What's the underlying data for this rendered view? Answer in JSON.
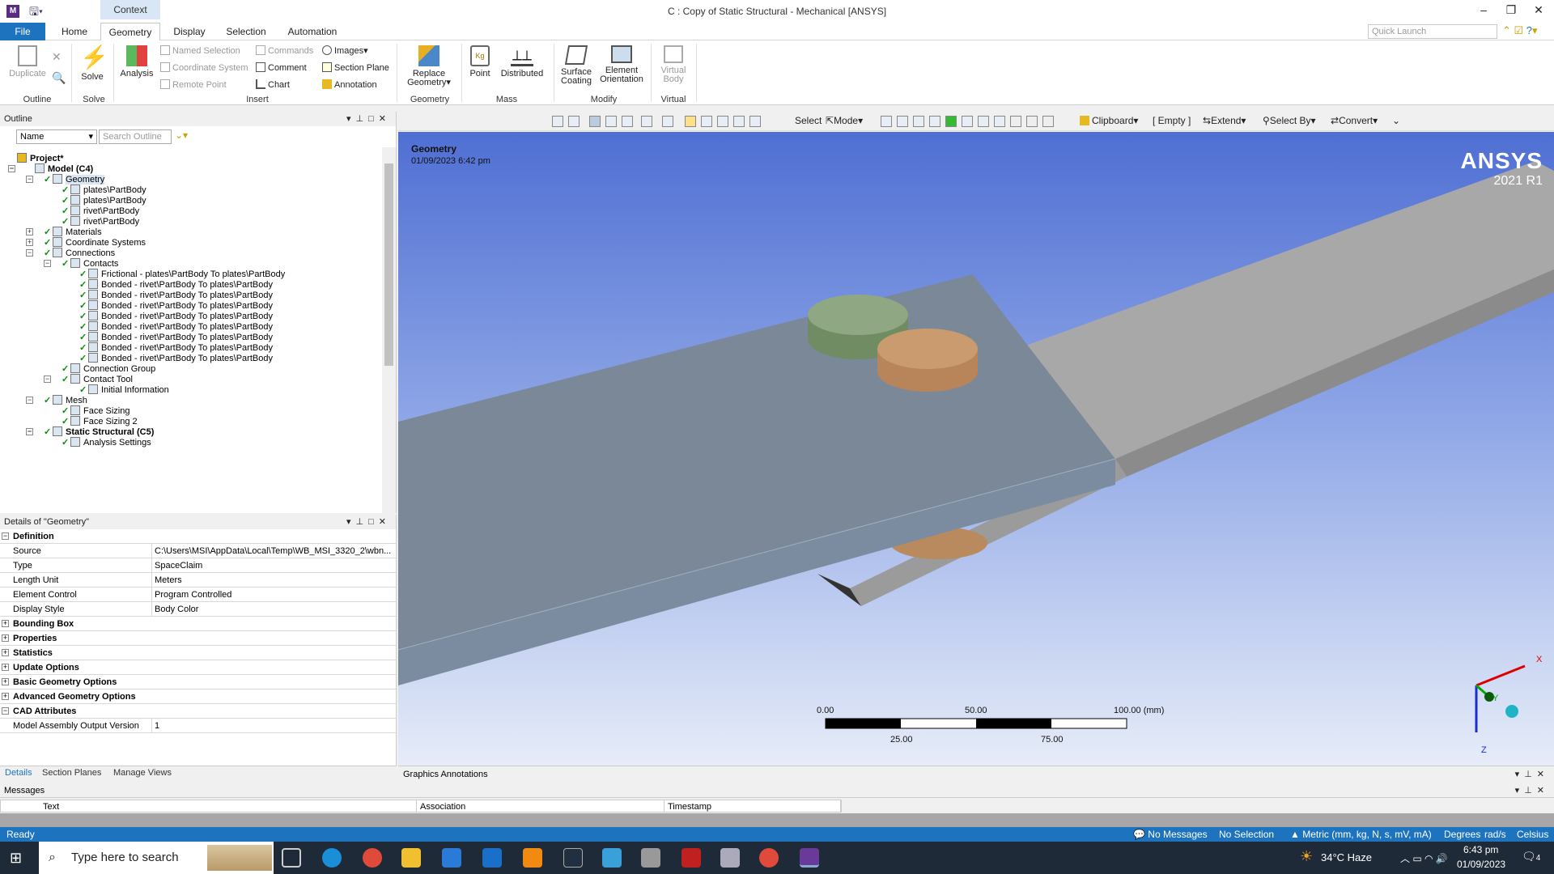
{
  "window": {
    "title": "C : Copy of Static Structural - Mechanical [ANSYS]",
    "context_tab": "Context",
    "min": "–",
    "max": "❐",
    "close": "✕"
  },
  "tabs": [
    "File",
    "Home",
    "Geometry",
    "Display",
    "Selection",
    "Automation"
  ],
  "quick_launch_placeholder": "Quick Launch",
  "ribbon": {
    "duplicate": "Duplicate",
    "outline_grp": "Outline",
    "solve": "Solve",
    "solve_grp": "Solve",
    "analysis": "Analysis",
    "named_selection": "Named Selection",
    "coordinate_system": "Coordinate System",
    "remote_point": "Remote Point",
    "commands": "Commands",
    "comment": "Comment",
    "chart": "Chart",
    "images": "Images",
    "section_plane": "Section Plane",
    "annotation": "Annotation",
    "insert_grp": "Insert",
    "replace_geometry_1": "Replace",
    "replace_geometry_2": "Geometry",
    "geometry_grp": "Geometry",
    "point": "Point",
    "distributed": "Distributed",
    "mass_grp": "Mass",
    "surface_coating_1": "Surface",
    "surface_coating_2": "Coating",
    "element_orientation_1": "Element",
    "element_orientation_2": "Orientation",
    "modify_grp": "Modify",
    "virtual_body_1": "Virtual",
    "virtual_body_2": "Body",
    "virtual_grp": "Virtual"
  },
  "outline": {
    "title": "Outline",
    "filter": "Name",
    "search_placeholder": "Search Outline"
  },
  "tree": [
    {
      "label": "Project*",
      "level": 0,
      "bold": true
    },
    {
      "label": "Model (C4)",
      "level": 1,
      "bold": true,
      "exp": "−"
    },
    {
      "label": "Geometry",
      "level": 2,
      "exp": "−",
      "check": true,
      "sel": true
    },
    {
      "label": "plates\\PartBody",
      "level": 3,
      "check": true
    },
    {
      "label": "plates\\PartBody",
      "level": 3,
      "check": true
    },
    {
      "label": "rivet\\PartBody",
      "level": 3,
      "check": true
    },
    {
      "label": "rivet\\PartBody",
      "level": 3,
      "check": true
    },
    {
      "label": "Materials",
      "level": 2,
      "exp": "+",
      "check": true
    },
    {
      "label": "Coordinate Systems",
      "level": 2,
      "exp": "+",
      "check": true
    },
    {
      "label": "Connections",
      "level": 2,
      "exp": "−",
      "check": true
    },
    {
      "label": "Contacts",
      "level": 3,
      "exp": "−",
      "check": true
    },
    {
      "label": "Frictional - plates\\PartBody To plates\\PartBody",
      "level": 4,
      "check": true
    },
    {
      "label": "Bonded - rivet\\PartBody To plates\\PartBody",
      "level": 4,
      "check": true
    },
    {
      "label": "Bonded - rivet\\PartBody To plates\\PartBody",
      "level": 4,
      "check": true
    },
    {
      "label": "Bonded - rivet\\PartBody To plates\\PartBody",
      "level": 4,
      "check": true
    },
    {
      "label": "Bonded - rivet\\PartBody To plates\\PartBody",
      "level": 4,
      "check": true
    },
    {
      "label": "Bonded - rivet\\PartBody To plates\\PartBody",
      "level": 4,
      "check": true
    },
    {
      "label": "Bonded - rivet\\PartBody To plates\\PartBody",
      "level": 4,
      "check": true
    },
    {
      "label": "Bonded - rivet\\PartBody To plates\\PartBody",
      "level": 4,
      "check": true
    },
    {
      "label": "Bonded - rivet\\PartBody To plates\\PartBody",
      "level": 4,
      "check": true
    },
    {
      "label": "Connection Group",
      "level": 3,
      "check": true
    },
    {
      "label": "Contact Tool",
      "level": 3,
      "exp": "−",
      "check": true
    },
    {
      "label": "Initial Information",
      "level": 4,
      "check": true
    },
    {
      "label": "Mesh",
      "level": 2,
      "exp": "−",
      "check": true
    },
    {
      "label": "Face Sizing",
      "level": 3,
      "check": true
    },
    {
      "label": "Face Sizing 2",
      "level": 3,
      "check": true
    },
    {
      "label": "Static Structural (C5)",
      "level": 2,
      "exp": "−",
      "check": true,
      "bold": true
    },
    {
      "label": "Analysis Settings",
      "level": 3,
      "check": true
    }
  ],
  "details": {
    "title": "Details of \"Geometry\"",
    "rows": [
      {
        "k": "Definition",
        "sec": true,
        "pm": "−"
      },
      {
        "k": "Source",
        "v": "C:\\Users\\MSI\\AppData\\Local\\Temp\\WB_MSI_3320_2\\wbn..."
      },
      {
        "k": "Type",
        "v": "SpaceClaim"
      },
      {
        "k": "Length Unit",
        "v": "Meters"
      },
      {
        "k": "Element Control",
        "v": "Program Controlled"
      },
      {
        "k": "Display Style",
        "v": "Body Color"
      },
      {
        "k": "Bounding Box",
        "sec": true,
        "pm": "+"
      },
      {
        "k": "Properties",
        "sec": true,
        "pm": "+"
      },
      {
        "k": "Statistics",
        "sec": true,
        "pm": "+"
      },
      {
        "k": "Update Options",
        "sec": true,
        "pm": "+"
      },
      {
        "k": "Basic Geometry Options",
        "sec": true,
        "pm": "+"
      },
      {
        "k": "Advanced Geometry Options",
        "sec": true,
        "pm": "+"
      },
      {
        "k": "CAD Attributes",
        "sec": true,
        "pm": "−"
      },
      {
        "k": "Model Assembly Output Version",
        "v": "1"
      }
    ],
    "tabs": [
      "Details",
      "Section Planes",
      "Manage Views"
    ]
  },
  "gtoolbar": {
    "select": "Select",
    "mode": "Mode",
    "clipboard": "Clipboard",
    "empty": "[ Empty ]",
    "extend": "Extend",
    "select_by": "Select By",
    "convert": "Convert"
  },
  "viewport": {
    "title": "Geometry",
    "date": "01/09/2023 6:42 pm",
    "logo": "ANSYS",
    "version": "2021 R1",
    "scale": {
      "s0": "0.00",
      "s50": "50.00",
      "s100": "100.00 (mm)",
      "s25": "25.00",
      "s75": "75.00"
    },
    "axes": {
      "x": "X",
      "y": "Y",
      "z": "Z"
    }
  },
  "graphics_annotations": "Graphics Annotations",
  "messages": {
    "title": "Messages",
    "cols": [
      "Text",
      "Association",
      "Timestamp"
    ]
  },
  "status": {
    "ready": "Ready",
    "no_messages": "No Messages",
    "no_selection": "No Selection",
    "units": "Metric (mm, kg, N, s, mV, mA)",
    "degrees": "Degrees",
    "rads": "rad/s",
    "celsius": "Celsius"
  },
  "taskbar": {
    "search": "Type here to search",
    "weather": "34°C  Haze",
    "time": "6:43 pm",
    "date": "01/09/2023",
    "notif": "4"
  },
  "colors": {
    "accent": "#1e73be",
    "viewport_top": "#4f6fd3",
    "plate": "#7d8da0",
    "rivet_green": "#8fa883",
    "rivet_orange": "#c99b6e"
  }
}
